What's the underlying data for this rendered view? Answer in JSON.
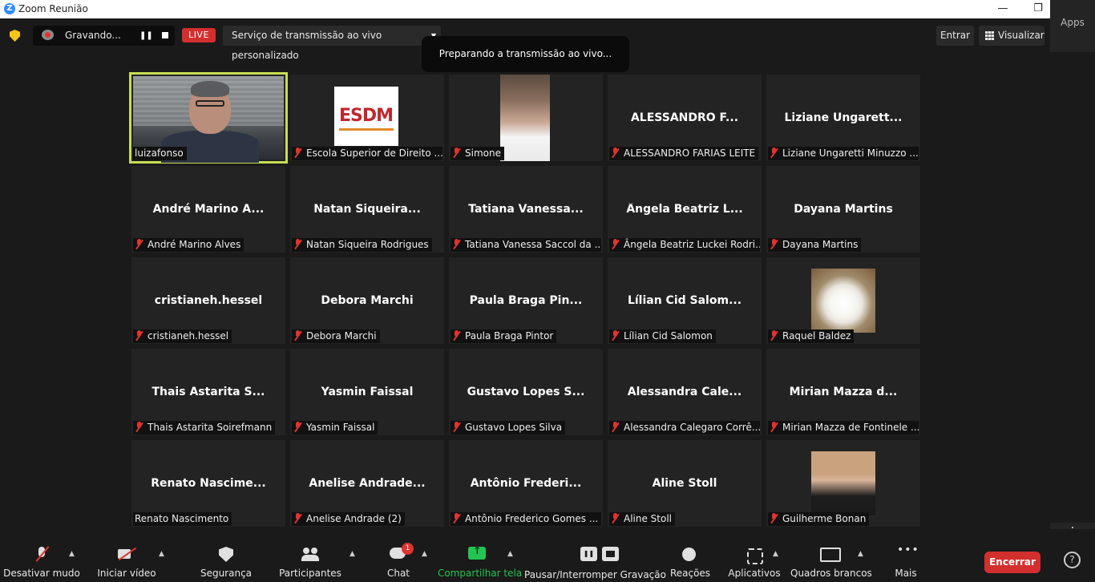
{
  "window": {
    "title": "Zoom Reunião",
    "logo": "Z",
    "minimize": "—",
    "maximize": "❐",
    "close": "✕"
  },
  "topbar": {
    "recording_label": "Gravando...",
    "live_badge": "LIVE",
    "stream_service": "Serviço de transmissão ao vivo personalizado",
    "toast": "Preparando a transmissão ao vivo...",
    "enter_label": "Entrar",
    "view_label": "Visualizar",
    "apps_label": "Apps"
  },
  "participants": [
    {
      "big": "",
      "name": "luizafonso",
      "muted": false,
      "kind": "video"
    },
    {
      "big": "",
      "name": "Escola Superior de Direito ...",
      "muted": true,
      "kind": "logo",
      "logo_text": "ESDM"
    },
    {
      "big": "",
      "name": "Simone",
      "muted": true,
      "kind": "photo-simone"
    },
    {
      "big": "ALESSANDRO F...",
      "name": "ALESSANDRO FARIAS LEITE",
      "muted": true
    },
    {
      "big": "Liziane Ungarett...",
      "name": "Liziane Ungaretti Minuzzo ...",
      "muted": true
    },
    {
      "big": "André Marino A...",
      "name": "André Marino Alves",
      "muted": true
    },
    {
      "big": "Natan Siqueira...",
      "name": "Natan Siqueira Rodrigues",
      "muted": true
    },
    {
      "big": "Tatiana Vanessa...",
      "name": "Tatiana Vanessa Saccol da ...",
      "muted": true
    },
    {
      "big": "Ângela Beatriz L...",
      "name": "Ângela Beatriz Luckei Rodri...",
      "muted": true
    },
    {
      "big": "Dayana Martins",
      "name": "Dayana Martins",
      "muted": true
    },
    {
      "big": "cristianeh.hessel",
      "name": "cristianeh.hessel",
      "muted": true
    },
    {
      "big": "Debora Marchi",
      "name": "Debora Marchi",
      "muted": true
    },
    {
      "big": "Paula Braga Pin...",
      "name": "Paula Braga Pintor",
      "muted": true
    },
    {
      "big": "Lílian Cid Salom...",
      "name": "Lílian Cid Salomon",
      "muted": true
    },
    {
      "big": "",
      "name": "Raquel Baldez",
      "muted": true,
      "kind": "photo-flower"
    },
    {
      "big": "Thais Astarita S...",
      "name": "Thais Astarita Soirefmann",
      "muted": true
    },
    {
      "big": "Yasmin Faissal",
      "name": "Yasmin Faissal",
      "muted": true
    },
    {
      "big": "Gustavo Lopes S...",
      "name": "Gustavo Lopes Silva",
      "muted": true
    },
    {
      "big": "Alessandra Cale...",
      "name": "Alessandra Calegaro Corrê...",
      "muted": true
    },
    {
      "big": "Mirian Mazza d...",
      "name": "Mirian Mazza de Fontinele ...",
      "muted": true
    },
    {
      "big": "Renato Nascime...",
      "name": "Renato Nascimento",
      "muted": false
    },
    {
      "big": "Anelise Andrade...",
      "name": "Anelise Andrade (2)",
      "muted": true
    },
    {
      "big": "Antônio Frederi...",
      "name": "Antônio Frederico Gomes ...",
      "muted": true
    },
    {
      "big": "Aline Stoll",
      "name": "Aline Stoll",
      "muted": true
    },
    {
      "big": "",
      "name": "Guilherme Bonan",
      "muted": true,
      "kind": "photo-guy"
    }
  ],
  "toolbar": {
    "mute": "Desativar mudo",
    "video": "Iniciar vídeo",
    "security": "Segurança",
    "participants": "Participantes",
    "chat": "Chat",
    "chat_badge": "1",
    "share": "Compartilhar tela",
    "record": "Pausar/Interromper Gravação",
    "reactions": "Reações",
    "apps": "Aplicativos",
    "whiteboards": "Quadros brancos",
    "more": "Mais",
    "end": "Encerrar",
    "help": "?"
  },
  "colors": {
    "accent": "#2d8cff",
    "live": "#d42f2f",
    "share": "#23c552",
    "active_speaker": "#c6de52",
    "muted": "#e0332e"
  }
}
